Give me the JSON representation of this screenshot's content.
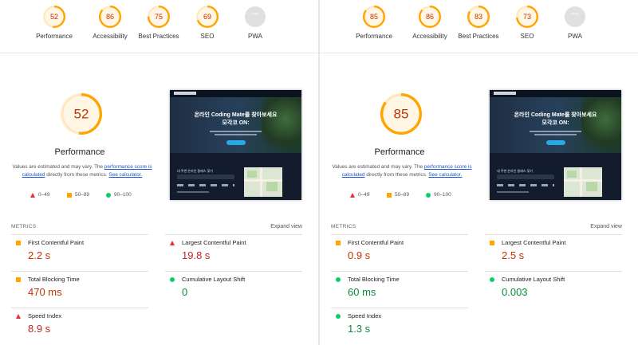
{
  "legend": {
    "fail": "0–49",
    "average": "50–89",
    "pass": "90–100"
  },
  "perf_text": {
    "pre": "Values are estimated and may vary. The ",
    "link1": "performance score is calculated",
    "mid": " directly from these metrics. ",
    "link2": "See calculator."
  },
  "metrics_label": "METRICS",
  "expand_label": "Expand view",
  "screenshot": {
    "heading_line1": "온라인 Coding Mate를 찾아보세요",
    "heading_line2": "모각코 ON:",
    "search_title": "내 주변 온라인 클래스 찾기"
  },
  "colors": {
    "fail": "#eb2f30",
    "average": "#ffa400",
    "pass": "#0cce6b",
    "pwa_gray": "#e0e0e0"
  },
  "left": {
    "categories": [
      {
        "label": "Performance",
        "score": "52",
        "status": "average"
      },
      {
        "label": "Accessibility",
        "score": "86",
        "status": "average"
      },
      {
        "label": "Best Practices",
        "score": "75",
        "status": "average"
      },
      {
        "label": "SEO",
        "score": "69",
        "status": "average"
      },
      {
        "label": "PWA",
        "score": "PWA",
        "status": "na"
      }
    ],
    "performance": {
      "score": "52",
      "title": "Performance",
      "fraction": 0.52
    },
    "metrics": [
      {
        "name": "First Contentful Paint",
        "value": "2.2 s",
        "status": "average"
      },
      {
        "name": "Largest Contentful Paint",
        "value": "19.8 s",
        "status": "fail"
      },
      {
        "name": "Total Blocking Time",
        "value": "470 ms",
        "status": "average"
      },
      {
        "name": "Cumulative Layout Shift",
        "value": "0",
        "status": "pass"
      },
      {
        "name": "Speed Index",
        "value": "8.9 s",
        "status": "fail"
      }
    ]
  },
  "right": {
    "categories": [
      {
        "label": "Performance",
        "score": "85",
        "status": "average"
      },
      {
        "label": "Accessibility",
        "score": "86",
        "status": "average"
      },
      {
        "label": "Best Practices",
        "score": "83",
        "status": "average"
      },
      {
        "label": "SEO",
        "score": "73",
        "status": "average"
      },
      {
        "label": "PWA",
        "score": "PWA",
        "status": "na"
      }
    ],
    "performance": {
      "score": "85",
      "title": "Performance",
      "fraction": 0.85
    },
    "metrics": [
      {
        "name": "First Contentful Paint",
        "value": "0.9 s",
        "status": "average"
      },
      {
        "name": "Largest Contentful Paint",
        "value": "2.5 s",
        "status": "average"
      },
      {
        "name": "Total Blocking Time",
        "value": "60 ms",
        "status": "pass"
      },
      {
        "name": "Cumulative Layout Shift",
        "value": "0.003",
        "status": "pass"
      },
      {
        "name": "Speed Index",
        "value": "1.3 s",
        "status": "pass"
      }
    ]
  }
}
